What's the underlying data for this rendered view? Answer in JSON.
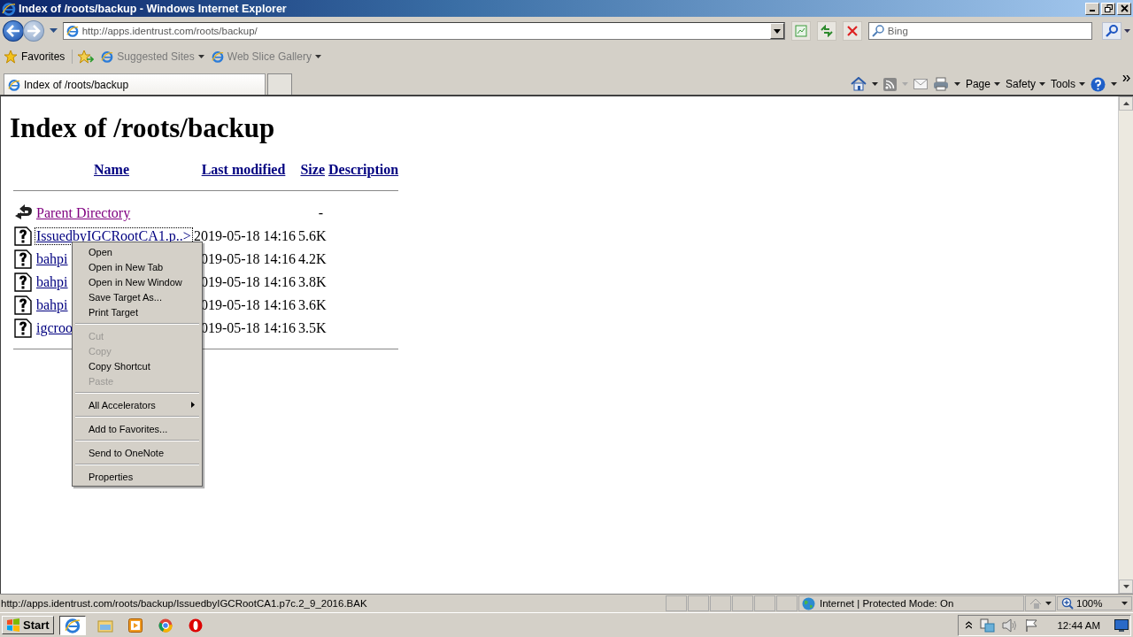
{
  "window": {
    "title": "Index of /roots/backup - Windows Internet Explorer"
  },
  "address_bar": {
    "value": "http://apps.identrust.com/roots/backup/"
  },
  "search": {
    "placeholder": "Bing"
  },
  "favorites_bar": {
    "favorites": "Favorites",
    "links": [
      {
        "label": "Suggested Sites"
      },
      {
        "label": "Web Slice Gallery"
      }
    ]
  },
  "tabs": [
    {
      "label": "Index of /roots/backup",
      "selected": true
    }
  ],
  "command_bar": [
    "Page",
    "Safety",
    "Tools"
  ],
  "page": {
    "heading": "Index of /roots/backup",
    "columns": [
      "Name",
      "Last modified",
      "Size",
      "Description"
    ],
    "rows": [
      {
        "kind": "parent",
        "name": "Parent Directory",
        "size": "-",
        "visited": true,
        "focused": false
      },
      {
        "kind": "file",
        "name": "IssuedbyIGCRootCA1.p..>",
        "modified": "2019-05-18 14:16",
        "size": "5.6K",
        "visited": false,
        "focused": true
      },
      {
        "kind": "file",
        "name": "bahpi",
        "modified": "019-05-18 14:16",
        "size": "4.2K",
        "visited": false,
        "focused": false
      },
      {
        "kind": "file",
        "name": "bahpi",
        "modified": "019-05-18 14:16",
        "size": "3.8K",
        "visited": false,
        "focused": false
      },
      {
        "kind": "file",
        "name": "bahpi",
        "modified": "019-05-18 14:16",
        "size": "3.6K",
        "visited": false,
        "focused": false
      },
      {
        "kind": "file",
        "name": "igcroo",
        "modified": "019-05-18 14:16",
        "size": "3.5K",
        "visited": false,
        "focused": false
      }
    ]
  },
  "context_menu": [
    {
      "kind": "item",
      "label": "Open",
      "disabled": false
    },
    {
      "kind": "item",
      "label": "Open in New Tab",
      "disabled": false
    },
    {
      "kind": "item",
      "label": "Open in New Window",
      "disabled": false
    },
    {
      "kind": "item",
      "label": "Save Target As...",
      "disabled": false
    },
    {
      "kind": "item",
      "label": "Print Target",
      "disabled": false
    },
    {
      "kind": "separator"
    },
    {
      "kind": "item",
      "label": "Cut",
      "disabled": true
    },
    {
      "kind": "item",
      "label": "Copy",
      "disabled": true
    },
    {
      "kind": "item",
      "label": "Copy Shortcut",
      "disabled": false
    },
    {
      "kind": "item",
      "label": "Paste",
      "disabled": true
    },
    {
      "kind": "separator"
    },
    {
      "kind": "submenu",
      "label": "All Accelerators",
      "disabled": false
    },
    {
      "kind": "separator"
    },
    {
      "kind": "item",
      "label": "Add to Favorites...",
      "disabled": false
    },
    {
      "kind": "separator"
    },
    {
      "kind": "item",
      "label": "Send to OneNote",
      "disabled": false
    },
    {
      "kind": "separator"
    },
    {
      "kind": "item",
      "label": "Properties",
      "disabled": false
    }
  ],
  "status_bar": {
    "text": "http://apps.identrust.com/roots/backup/IssuedbyIGCRootCA1.p7c.2_9_2016.BAK",
    "zone": "Internet | Protected Mode: On",
    "zoom": "100%"
  },
  "taskbar": {
    "start": "Start",
    "apps": [
      {
        "kind": "ie",
        "selected": true
      },
      {
        "kind": "folder",
        "selected": false
      },
      {
        "kind": "media",
        "selected": false
      },
      {
        "kind": "chrome",
        "selected": false
      },
      {
        "kind": "opera",
        "selected": false
      }
    ],
    "clock": "12:44 AM"
  }
}
